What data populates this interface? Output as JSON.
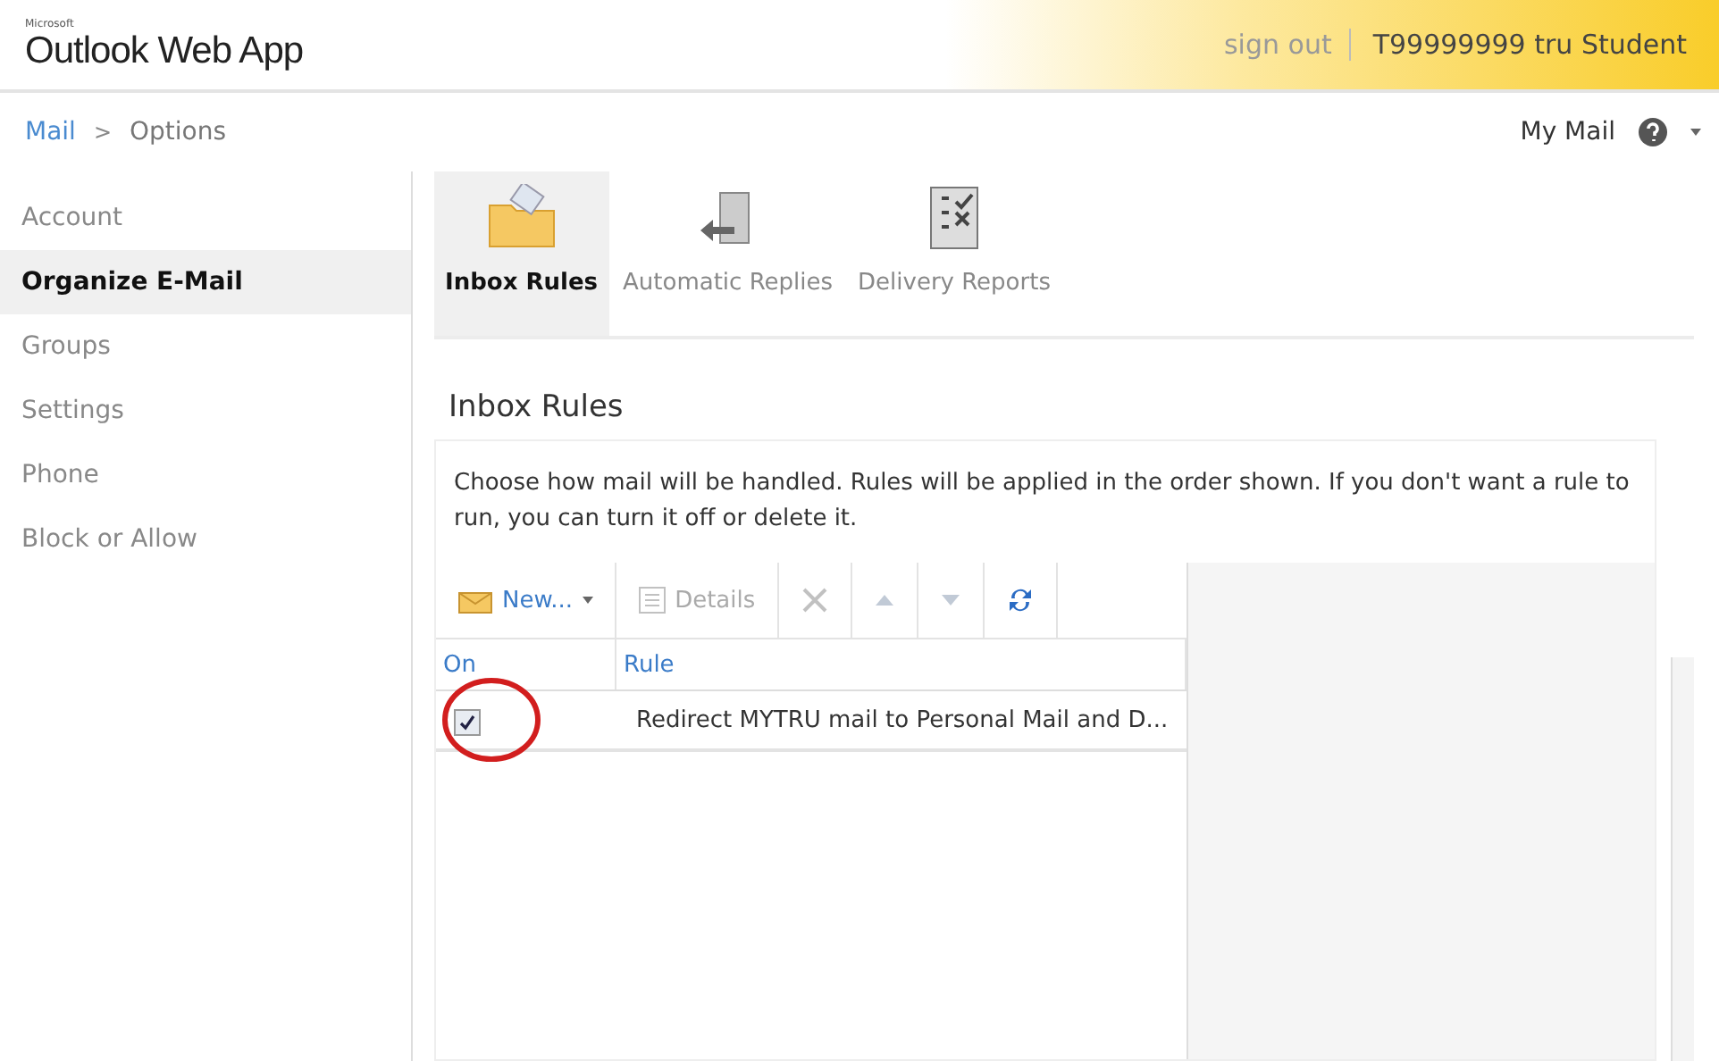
{
  "header": {
    "brand_small": "Microsoft",
    "brand": "Outlook Web App",
    "sign_out": "sign out",
    "user": "T99999999 tru Student"
  },
  "breadcrumb": {
    "items": [
      "Mail",
      "Options"
    ],
    "separator": ">"
  },
  "top_right": {
    "my_mail": "My Mail"
  },
  "sidebar": {
    "items": [
      {
        "label": "Account",
        "selected": false
      },
      {
        "label": "Organize E-Mail",
        "selected": true
      },
      {
        "label": "Groups",
        "selected": false
      },
      {
        "label": "Settings",
        "selected": false
      },
      {
        "label": "Phone",
        "selected": false
      },
      {
        "label": "Block or Allow",
        "selected": false
      }
    ]
  },
  "tabs": [
    {
      "label": "Inbox Rules",
      "kind": "folder",
      "selected": true
    },
    {
      "label": "Automatic Replies",
      "kind": "door",
      "selected": false
    },
    {
      "label": "Delivery Reports",
      "kind": "report",
      "selected": false
    }
  ],
  "section": {
    "title": "Inbox Rules",
    "description": "Choose how mail will be handled. Rules will be applied in the order shown. If you don't want a rule to run, you can turn it off or delete it."
  },
  "toolbar": [
    {
      "kind": "new",
      "label": "New...",
      "disabled": false
    },
    {
      "kind": "details",
      "label": "Details",
      "disabled": true
    },
    {
      "kind": "delete",
      "disabled": true
    },
    {
      "kind": "up",
      "disabled": true
    },
    {
      "kind": "down",
      "disabled": true
    },
    {
      "kind": "refresh",
      "disabled": false
    }
  ],
  "table": {
    "columns": [
      "On",
      "Rule"
    ],
    "rows": [
      {
        "checked": true,
        "rule": "Redirect MYTRU mail to Personal Mail and D...",
        "highlighted": true
      }
    ]
  }
}
